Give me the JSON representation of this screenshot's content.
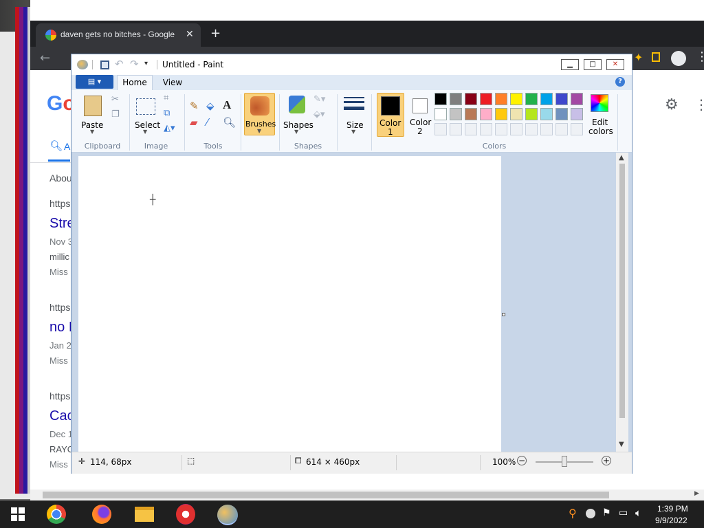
{
  "chrome": {
    "tab_title": "daven gets no bitches - Google",
    "results_tab_prefix": "A",
    "about_text": "Abou",
    "results": [
      {
        "url": "https",
        "title": "Stre",
        "snip1": "Nov 3",
        "snip2": "millic",
        "snip3": "Miss"
      },
      {
        "url": "https",
        "title": "no I",
        "snip1": "Jan 2",
        "snip2": "Miss",
        "snip3": ""
      },
      {
        "url": "https",
        "title": "Cac",
        "snip1": "Dec 1",
        "snip2": "RAYC",
        "snip3": "Miss"
      }
    ]
  },
  "paint": {
    "title": "Untitled - Paint",
    "tabs": {
      "home": "Home",
      "view": "View"
    },
    "groups": {
      "clipboard": "Clipboard",
      "image": "Image",
      "tools": "Tools",
      "shapes": "Shapes",
      "colors": "Colors"
    },
    "buttons": {
      "paste": "Paste",
      "select": "Select",
      "brushes": "Brushes",
      "shapes": "Shapes",
      "size": "Size",
      "color1_line1": "Color",
      "color1_line2": "1",
      "color2_line1": "Color",
      "color2_line2": "2",
      "edit_colors_line1": "Edit",
      "edit_colors_line2": "colors"
    },
    "colors": {
      "color1": "#000000",
      "color2": "#ffffff",
      "row1": [
        "#000000",
        "#7f7f7f",
        "#880015",
        "#ed1c24",
        "#ff7f27",
        "#fff200",
        "#22b14c",
        "#00a2e8",
        "#3f48cc",
        "#a349a4"
      ],
      "row2": [
        "#ffffff",
        "#c3c3c3",
        "#b97a57",
        "#ffaec9",
        "#ffc90e",
        "#efe4b0",
        "#b5e61d",
        "#99d9ea",
        "#7092be",
        "#c8bfe7"
      ]
    },
    "status": {
      "cursor_pos": "114, 68px",
      "canvas_size": "614 × 460px",
      "zoom": "100%"
    }
  },
  "taskbar": {
    "time": "1:39 PM",
    "date": "9/9/2022"
  }
}
